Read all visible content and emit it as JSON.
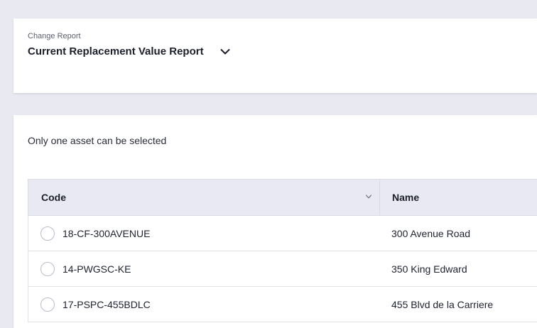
{
  "report": {
    "label": "Change Report",
    "title": "Current Replacement Value Report",
    "dropdown_icon": "chevron-down-icon"
  },
  "assets": {
    "hint": "Only one asset can be selected",
    "columns": {
      "code": "Code",
      "name": "Name"
    },
    "rows": [
      {
        "code": "18-CF-300AVENUE",
        "name": "300 Avenue Road"
      },
      {
        "code": "14-PWGSC-KE",
        "name": "350 King Edward"
      },
      {
        "code": "17-PSPC-455BDLC",
        "name": "455 Blvd de la Carriere"
      }
    ]
  },
  "colors": {
    "background": "#e9eaf1",
    "header_bg": "#e8e9f2",
    "text": "#1f2230"
  }
}
